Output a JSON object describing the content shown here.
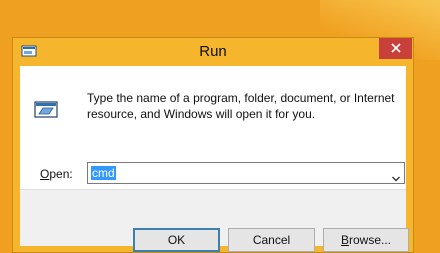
{
  "window": {
    "title": "Run",
    "icons": {
      "title": "run-icon",
      "close": "close-icon",
      "program": "run-program-icon",
      "dropdown": "chevron-down-icon"
    }
  },
  "body": {
    "description": "Type the name of a program, folder, document, or Internet resource, and Windows will open it for you.",
    "open_label_accel": "O",
    "open_label_rest": "pen:",
    "open_value": "cmd"
  },
  "buttons": {
    "ok": "OK",
    "cancel": "Cancel",
    "browse_accel": "B",
    "browse_rest": "rowse..."
  },
  "colors": {
    "desktop": "#f0a020",
    "frame": "#f5b52c",
    "close": "#c7403a",
    "selection": "#3399ff"
  }
}
